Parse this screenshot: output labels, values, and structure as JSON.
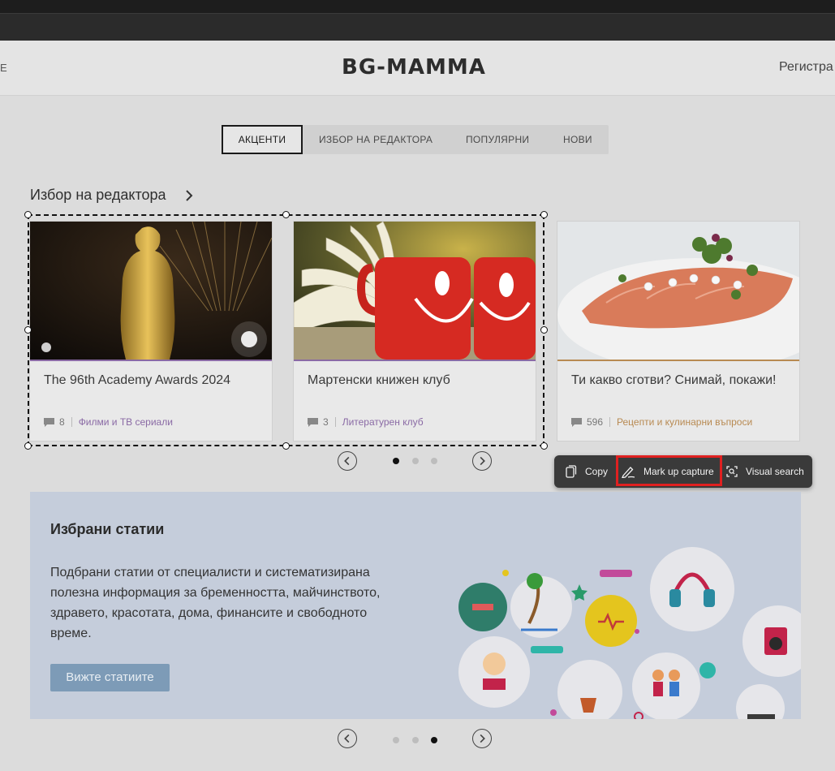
{
  "site": {
    "header_left": "E",
    "logo": "BG-MAMMA",
    "header_right": "Регистра"
  },
  "tabs": [
    {
      "label": "АКЦЕНТИ",
      "active": true
    },
    {
      "label": "ИЗБОР НА РЕДАКТОРА",
      "active": false
    },
    {
      "label": "ПОПУЛЯРНИ",
      "active": false
    },
    {
      "label": "НОВИ",
      "active": false
    }
  ],
  "editor_choice": {
    "title": "Избор на редактора",
    "cards": [
      {
        "title": "The 96th Academy Awards 2024",
        "comments": "8",
        "category": "Филми и ТВ сериали",
        "image": "oscar-statue"
      },
      {
        "title": "Мартенски книжен клуб",
        "comments": "3",
        "category": "Литературен клуб",
        "image": "book-and-mugs"
      },
      {
        "title": "Ти какво сготви? Снимай, покажи!",
        "comments": "596",
        "category": "Рецепти и кулинарни въпроси",
        "image": "salmon-dish"
      }
    ],
    "pager_dots": 3,
    "active_dot": 0
  },
  "capture_popup": {
    "copy": "Copy",
    "markup": "Mark up capture",
    "visual_search": "Visual search",
    "highlighted": "markup"
  },
  "featured": {
    "title": "Избрани статии",
    "text": "Подбрани статии от специалисти и систематизирана полезна информация за бременността, майчинството, здравето, красотата, дома, финансите и свободното време.",
    "button": "Вижте статиите",
    "pager_dots": 3,
    "active_dot": 2
  },
  "colors": {
    "accent_purple": "#8a6aa5",
    "accent_orange": "#b88a52",
    "highlight_red": "#e02020",
    "featured_bg": "#c5cddb",
    "button_blue": "#7d9bb7"
  }
}
